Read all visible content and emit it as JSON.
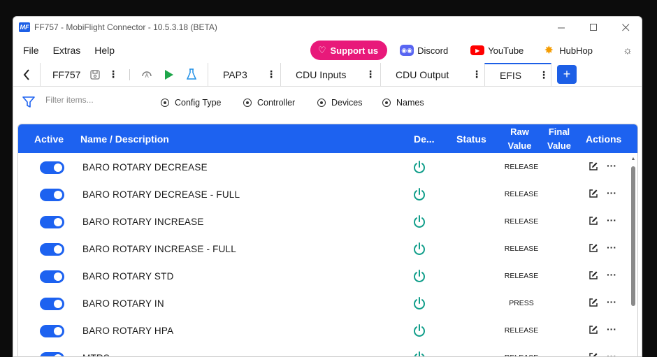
{
  "window": {
    "logo": "MF",
    "title": "FF757 - MobiFlight Connector - 10.5.3.18 (BETA)",
    "controls": [
      "minimize-icon",
      "maximize-icon",
      "close-icon"
    ]
  },
  "menu": {
    "items": [
      "File",
      "Extras",
      "Help"
    ],
    "support_label": "Support us",
    "discord_label": "Discord",
    "youtube_label": "YouTube",
    "hubhop_label": "HubHop"
  },
  "tabs": {
    "project_tab": "FF757",
    "items": [
      {
        "label": "PAP3"
      },
      {
        "label": "CDU Inputs"
      },
      {
        "label": "CDU Output"
      },
      {
        "label": "EFIS",
        "active": true
      }
    ],
    "add_label": "+"
  },
  "filter": {
    "placeholder": "Filter items...",
    "options": [
      "Config Type",
      "Controller",
      "Devices",
      "Names"
    ]
  },
  "table": {
    "headers": {
      "active": "Active",
      "name": "Name / Description",
      "device": "De...",
      "status": "Status",
      "raw_value_1": "Raw",
      "raw_value_2": "Value",
      "final_value_1": "Final",
      "final_value_2": "Value",
      "actions": "Actions"
    },
    "rows": [
      {
        "name": "BARO ROTARY DECREASE",
        "raw": "RELEASE",
        "active": true
      },
      {
        "name": "BARO ROTARY DECREASE - FULL",
        "raw": "RELEASE",
        "active": true
      },
      {
        "name": "BARO ROTARY INCREASE",
        "raw": "RELEASE",
        "active": true
      },
      {
        "name": "BARO ROTARY INCREASE - FULL",
        "raw": "RELEASE",
        "active": true
      },
      {
        "name": "BARO ROTARY STD",
        "raw": "RELEASE",
        "active": true
      },
      {
        "name": "BARO ROTARY IN",
        "raw": "PRESS",
        "active": true
      },
      {
        "name": "BARO ROTARY HPA",
        "raw": "RELEASE",
        "active": true
      },
      {
        "name": "MTRS",
        "raw": "RELEASE",
        "active": true
      }
    ]
  },
  "colors": {
    "accent": "#1d62f0",
    "support": "#e8197a",
    "power": "#119e8a"
  }
}
